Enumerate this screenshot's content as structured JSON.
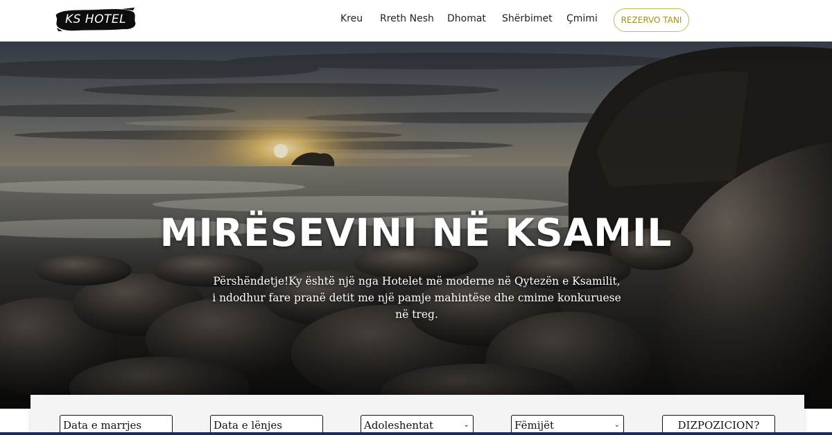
{
  "brand": {
    "logo_text": "KS HOTEL"
  },
  "nav": {
    "items": [
      {
        "label": "Kreu"
      },
      {
        "label": "Rreth Nesh"
      },
      {
        "label": "Dhomat"
      },
      {
        "label": "Shërbimet"
      },
      {
        "label": "Çmimi"
      }
    ],
    "cta_label": "REZERVO TANI"
  },
  "hero": {
    "title": "MIRËSEVINI NË KSAMIL",
    "subtitle": "Përshëndetje!Ky është një nga Hotelet më moderne në Qytezën e Ksamilit, i ndodhur fare pranë detit me një pamje mahintëse dhe cmime konkuruese në treg."
  },
  "booking": {
    "checkin_placeholder": "Data e marrjes",
    "checkout_placeholder": "Data e lënjes",
    "adults_selected": "Adoleshentat",
    "children_selected": "Fëmijët",
    "submit_label": "DIZPOZICION?"
  },
  "colors": {
    "accent": "#c9b64a",
    "accent_text": "#a48f1c",
    "nav_text": "#222222",
    "booking_bg": "#f4f4f4",
    "bottom_bar": "#1d2b5a"
  },
  "icons": {
    "select_arrow": "chevron-down-icon"
  }
}
